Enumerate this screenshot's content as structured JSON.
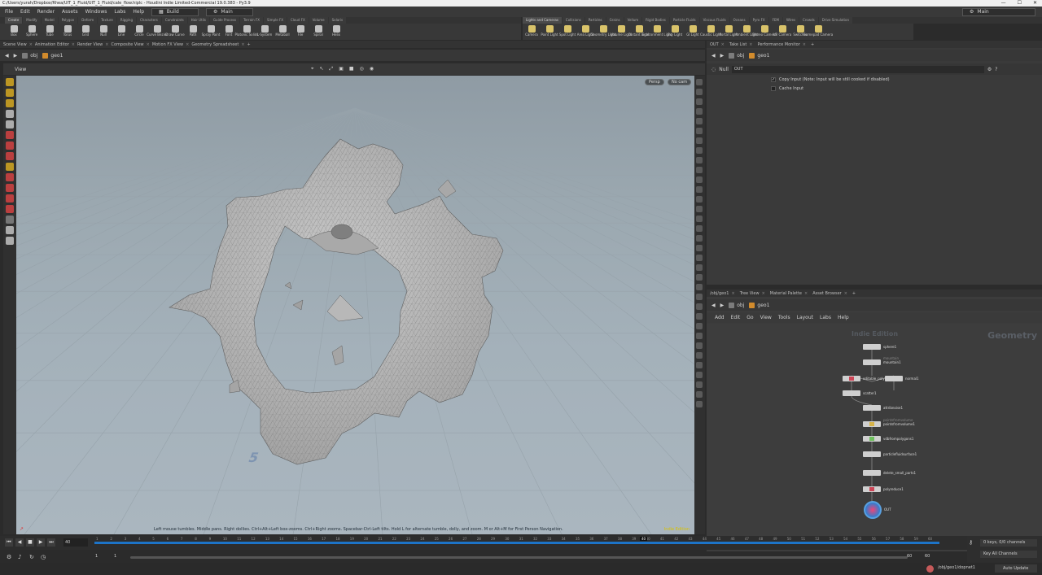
{
  "window": {
    "title": "C:/Users/yurah/Dropbox/Rhea/UIT_1_Fluid/UIT_1_Fluid/cale_flow.hiplc - Houdini Indie Limited-Commercial 19.0.383 - Py3.9",
    "minimize": "—",
    "maximize": "☐",
    "close": "✕"
  },
  "menubar": {
    "items": [
      "File",
      "Edit",
      "Render",
      "Assets",
      "Windows",
      "Labs",
      "Help"
    ],
    "desktop": "Build",
    "main": "Main",
    "right": "Main"
  },
  "shelf_tabs": [
    "Create",
    "Modify",
    "Model",
    "Polygon",
    "Deform",
    "Texture",
    "Rigging",
    "Characters",
    "Constraints",
    "Hair Utils",
    "Guide Process",
    "Terrain FX",
    "Simple FX",
    "Cloud FX",
    "Volume",
    "Solaris"
  ],
  "shelf_tools": [
    "Box",
    "Sphere",
    "Tube",
    "Torus",
    "Grid",
    "Null",
    "Line",
    "Circle",
    "Curve Bezier",
    "Draw Curve",
    "Path",
    "Spray Paint",
    "Font",
    "Platonic Solids",
    "L-System",
    "Metaball",
    "File",
    "Spiral",
    "Helix"
  ],
  "shelf_tabs2": [
    "Lights and Cameras",
    "Collisions",
    "Particles",
    "Grains",
    "Vellum",
    "Rigid Bodies",
    "Particle Fluids",
    "Viscous Fluids",
    "Oceans",
    "Pyro FX",
    "FEM",
    "Wires",
    "Crowds",
    "Drive Simulation"
  ],
  "shelf_tools2": [
    "Camera",
    "Point Light",
    "Spot Light",
    "Area Light",
    "Geometry Light",
    "Volume Light",
    "Distant Light",
    "Environment Light",
    "Sky Light",
    "GI Light",
    "Caustic Light",
    "Portal Light",
    "Ambient Light",
    "Stereo Camera",
    "VR Camera",
    "Switcher",
    "Gamepad Camera"
  ],
  "left_pane": {
    "tabs": [
      "Scene View",
      "Animation Editor",
      "Render View",
      "Composite View",
      "Motion FX View",
      "Geometry Spreadsheet"
    ],
    "path": [
      "obj",
      "geo1"
    ],
    "view_label": "View",
    "persp": "Persp",
    "camera": "No cam",
    "help": "Left mouse tumbles. Middle pans. Right dollies. Ctrl+Alt+Left box-zooms. Ctrl+Right zooms. Spacebar-Ctrl-Left tilts. Hold L for alternate tumble, dolly, and zoom.    M or Alt+M for First Person Navigation.",
    "ws": "Indie Edition",
    "grid_label": "5"
  },
  "right_top": {
    "tabs": [
      "OUT",
      "Take List",
      "Performance Monitor"
    ],
    "path": [
      "obj",
      "geo1"
    ],
    "node_type": "Null",
    "node_name": "OUT",
    "params": [
      {
        "label": "Copy Input (Note: Input will be still cooked if disabled)",
        "checked": true
      },
      {
        "label": "Cache Input",
        "checked": false
      }
    ]
  },
  "right_bottom": {
    "tabs": [
      "/obj/geo1",
      "Tree View",
      "Material Palette",
      "Asset Browser"
    ],
    "path": [
      "obj",
      "geo1"
    ],
    "menu": [
      "Add",
      "Edit",
      "Go",
      "View",
      "Tools",
      "Layout",
      "Labs",
      "Help"
    ],
    "watermark": "Indie Edition",
    "context": "Geometry",
    "nodes": [
      {
        "name": "sphere1"
      },
      {
        "name": "mountain1",
        "sub": "mountain"
      },
      {
        "name": "editable_poly"
      },
      {
        "name": "normal1"
      },
      {
        "name": "scatter1"
      },
      {
        "name": "attribnoise1"
      },
      {
        "name": "pointsfromvolume1",
        "sub": "pointsfromvolume"
      },
      {
        "name": "vdbfrompolygons1"
      },
      {
        "name": "particlefluidsurface1"
      },
      {
        "name": "delete_small_parts1"
      },
      {
        "name": "polyreduce1"
      },
      {
        "name": "OUT"
      }
    ]
  },
  "timeline": {
    "current_frame": "40",
    "start": "1",
    "start2": "1",
    "end": "60",
    "end2": "60",
    "ticks": [
      "1",
      "2",
      "3",
      "4",
      "5",
      "6",
      "7",
      "8",
      "9",
      "10",
      "11",
      "12",
      "13",
      "14",
      "15",
      "16",
      "17",
      "18",
      "19",
      "20",
      "21",
      "22",
      "23",
      "24",
      "25",
      "26",
      "27",
      "28",
      "29",
      "30",
      "31",
      "32",
      "33",
      "34",
      "35",
      "36",
      "37",
      "38",
      "39",
      "40",
      "41",
      "42",
      "43",
      "44",
      "45",
      "46",
      "47",
      "48",
      "49",
      "50",
      "51",
      "52",
      "53",
      "54",
      "55",
      "56",
      "57",
      "58",
      "59",
      "60"
    ],
    "keys": "0 keys, 0/0 channels",
    "key_all": "Key All Channels",
    "auto_update": "Auto Update",
    "status_path": "/obj/geo1/dopnet1"
  },
  "colors": {
    "accent": "#1d74c8",
    "mesh": "#b9b9b9",
    "viewport_top": "#8f9ba4",
    "viewport_bottom": "#aab6bf",
    "ws_text": "#d8c200"
  }
}
